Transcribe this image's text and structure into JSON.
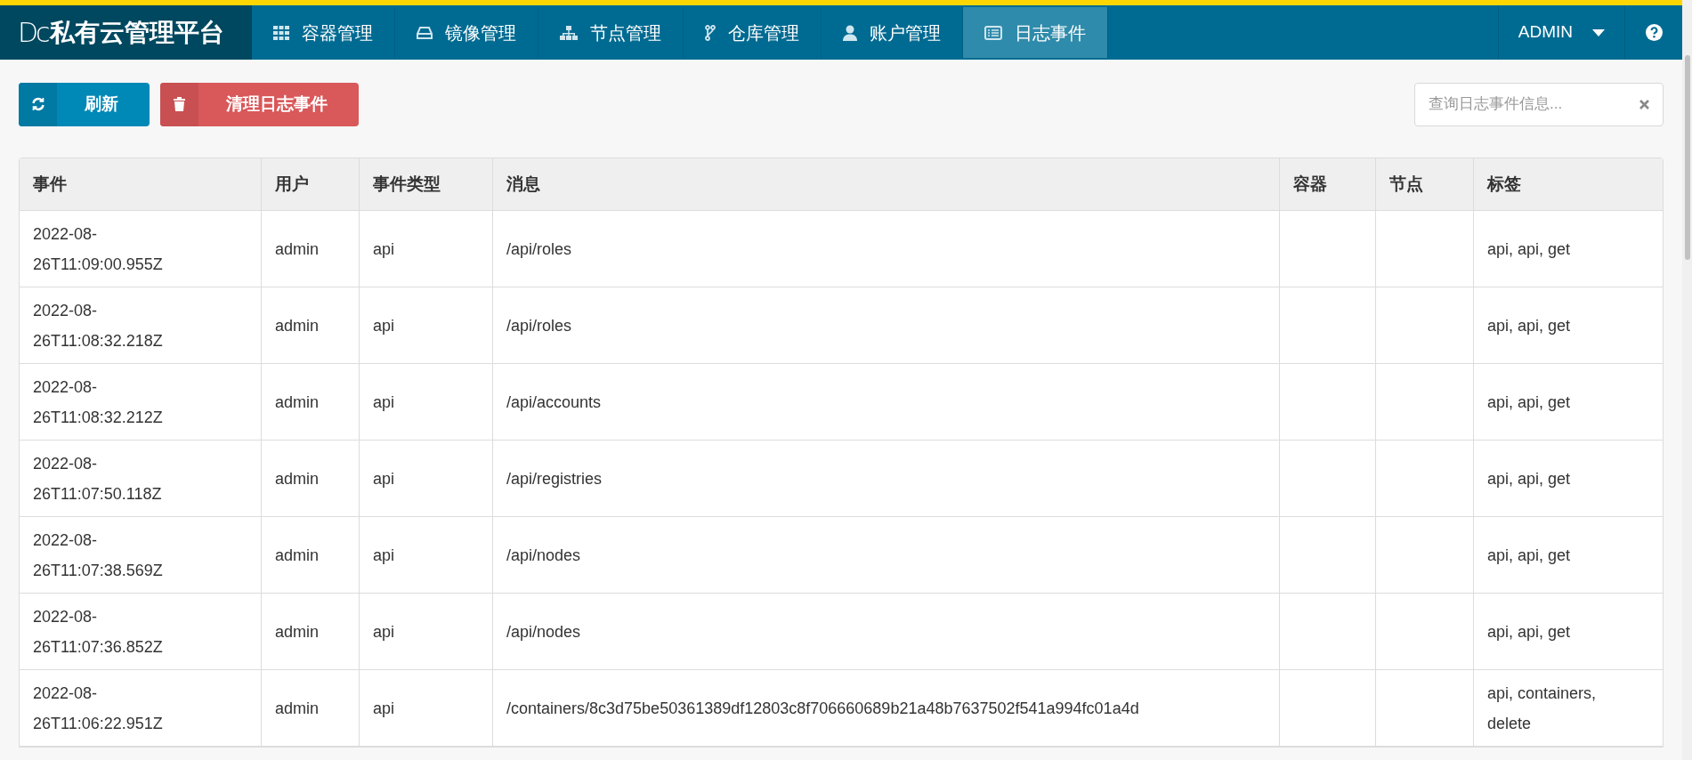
{
  "brand": {
    "logo": "Dc",
    "title": "私有云管理平台"
  },
  "nav": [
    {
      "label": "容器管理",
      "kind": "grid",
      "selected": false
    },
    {
      "label": "镜像管理",
      "kind": "drive",
      "selected": false
    },
    {
      "label": "节点管理",
      "kind": "sitemap",
      "selected": false
    },
    {
      "label": "仓库管理",
      "kind": "fork",
      "selected": false
    },
    {
      "label": "账户管理",
      "kind": "user",
      "selected": false
    },
    {
      "label": "日志事件",
      "kind": "list",
      "selected": true
    }
  ],
  "user_menu": {
    "label": "ADMIN"
  },
  "toolbar": {
    "buttons": [
      {
        "label": "刷新",
        "kind": "refresh"
      },
      {
        "label": "清理日志事件",
        "kind": "clear"
      }
    ],
    "search": {
      "placeholder": "查询日志事件信息..."
    }
  },
  "table": {
    "columns": [
      "事件",
      "用户",
      "事件类型",
      "消息",
      "容器",
      "节点",
      "标签"
    ],
    "rows": [
      [
        "2022-08-26T11:09:00.955Z",
        "admin",
        "api",
        "/api/roles",
        "",
        "",
        "api, api, get"
      ],
      [
        "2022-08-26T11:08:32.218Z",
        "admin",
        "api",
        "/api/roles",
        "",
        "",
        "api, api, get"
      ],
      [
        "2022-08-26T11:08:32.212Z",
        "admin",
        "api",
        "/api/accounts",
        "",
        "",
        "api, api, get"
      ],
      [
        "2022-08-26T11:07:50.118Z",
        "admin",
        "api",
        "/api/registries",
        "",
        "",
        "api, api, get"
      ],
      [
        "2022-08-26T11:07:38.569Z",
        "admin",
        "api",
        "/api/nodes",
        "",
        "",
        "api, api, get"
      ],
      [
        "2022-08-26T11:07:36.852Z",
        "admin",
        "api",
        "/api/nodes",
        "",
        "",
        "api, api, get"
      ],
      [
        "2022-08-26T11:06:22.951Z",
        "admin",
        "api",
        "/containers/8c3d75be50361389df12803c8f706660689b21a48b7637502f541a994fc01a4d",
        "",
        "",
        "api, containers, delete"
      ]
    ]
  }
}
